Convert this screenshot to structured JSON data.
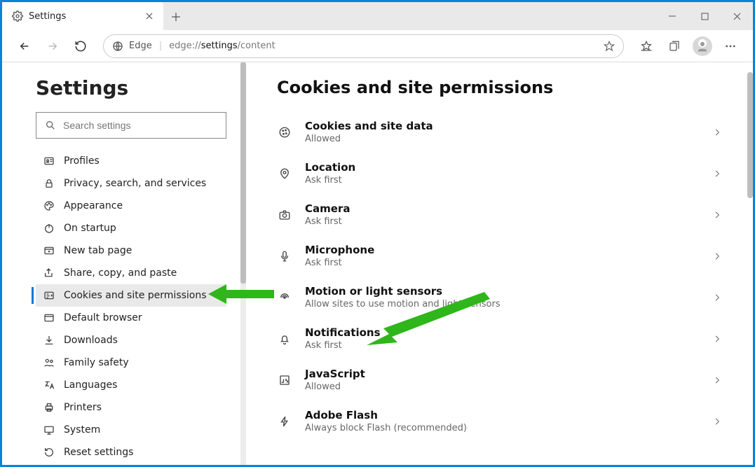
{
  "tab": {
    "title": "Settings"
  },
  "toolbar": {
    "brand": "Edge",
    "url_prefix": "edge://",
    "url_bold": "settings",
    "url_suffix": "/content"
  },
  "sidebar": {
    "heading": "Settings",
    "search_placeholder": "Search settings",
    "items": [
      {
        "label": "Profiles",
        "icon": "profile-card-icon"
      },
      {
        "label": "Privacy, search, and services",
        "icon": "lock-icon"
      },
      {
        "label": "Appearance",
        "icon": "palette-icon"
      },
      {
        "label": "On startup",
        "icon": "power-icon"
      },
      {
        "label": "New tab page",
        "icon": "newtab-icon"
      },
      {
        "label": "Share, copy, and paste",
        "icon": "share-icon"
      },
      {
        "label": "Cookies and site permissions",
        "icon": "permissions-icon"
      },
      {
        "label": "Default browser",
        "icon": "browser-icon"
      },
      {
        "label": "Downloads",
        "icon": "download-icon"
      },
      {
        "label": "Family safety",
        "icon": "family-icon"
      },
      {
        "label": "Languages",
        "icon": "language-icon"
      },
      {
        "label": "Printers",
        "icon": "printer-icon"
      },
      {
        "label": "System",
        "icon": "system-icon"
      },
      {
        "label": "Reset settings",
        "icon": "reset-icon"
      }
    ],
    "active_index": 6
  },
  "main": {
    "heading": "Cookies and site permissions",
    "items": [
      {
        "title": "Cookies and site data",
        "sub": "Allowed",
        "icon": "cookie-icon"
      },
      {
        "title": "Location",
        "sub": "Ask first",
        "icon": "location-icon"
      },
      {
        "title": "Camera",
        "sub": "Ask first",
        "icon": "camera-icon"
      },
      {
        "title": "Microphone",
        "sub": "Ask first",
        "icon": "mic-icon"
      },
      {
        "title": "Motion or light sensors",
        "sub": "Allow sites to use motion and light sensors",
        "icon": "sensor-icon"
      },
      {
        "title": "Notifications",
        "sub": "Ask first",
        "icon": "bell-icon"
      },
      {
        "title": "JavaScript",
        "sub": "Allowed",
        "icon": "js-icon"
      },
      {
        "title": "Adobe Flash",
        "sub": "Always block Flash (recommended)",
        "icon": "flash-icon"
      }
    ]
  }
}
